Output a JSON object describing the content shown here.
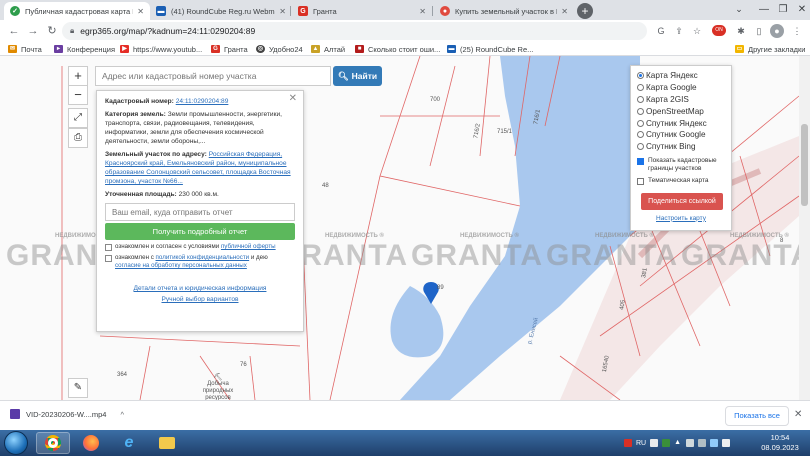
{
  "browser": {
    "tabs": [
      {
        "title": "Публичная кадастровая карта Р",
        "favicon": "check",
        "color": "#2e9d4c",
        "active": true
      },
      {
        "title": "(41) RoundCube Reg.ru Webmail",
        "favicon": "mail",
        "color": "#1a5fb4",
        "active": false
      },
      {
        "title": "Гранта",
        "favicon": "G",
        "color": "#d93025",
        "active": false
      },
      {
        "title": "Купить земельный участок в Кр",
        "favicon": "pin",
        "color": "#e04a3f",
        "active": false
      }
    ],
    "url": "egrp365.org/map/?kadnum=24:11:0290204:89",
    "bookmarks": [
      {
        "label": "Почта",
        "color": "#e08a00"
      },
      {
        "label": "Конференция",
        "color": "#6a3ea1"
      },
      {
        "label": "https://www.youtub...",
        "color": "#e52d27"
      },
      {
        "label": "Гранта",
        "color": "#d93025"
      },
      {
        "label": "Удобно24",
        "color": "#444444"
      },
      {
        "label": "Алтай",
        "color": "#c9a227"
      },
      {
        "label": "Сколько стоит оши...",
        "color": "#b31b1b"
      },
      {
        "label": "(25) RoundCube Re...",
        "color": "#1a5fb4"
      }
    ],
    "other_bookmarks": "Другие закладки"
  },
  "map": {
    "search": {
      "placeholder": "Адрес или кадастровый номер участка",
      "button": "Найти"
    },
    "zoom_in": "+",
    "zoom_out": "−",
    "labels": [
      "700",
      "716/2",
      "716/1",
      "715/1",
      "48",
      "89",
      "76",
      "364",
      "Добыча природных ресурсов",
      "р. Енисей",
      "381",
      "405",
      "16540",
      "8"
    ],
    "watermark": "GRANTA",
    "watermark_small": "НЕДВИЖИМОСТЬ ®"
  },
  "info": {
    "cadnum_label": "Кадастровый номер:",
    "cadnum": "24:11:0290204:89",
    "category_label": "Категория земель:",
    "category": "Земли промышленности, энергетики, транспорта, связи, радиовещания, телевидения, информатики, земли для обеспечения космической деятельности, земли обороны,...",
    "address_label": "Земельный участок по адресу:",
    "address": "Российская Федерация, Красноярский край, Емельяновский район, муниципальное образование Солонцовский сельсовет, площадка Восточная промзона, участок №66...",
    "area_label": "Уточненная площадь:",
    "area": "230 000 кв.м.",
    "email_placeholder": "Ваш email, куда отправить отчет",
    "get_report": "Получить подробный отчет",
    "consent1_pre": "ознакомлен и согласен с условиями ",
    "consent1_link": "публичной оферты",
    "consent2_pre": "ознакомлен с ",
    "consent2_link1": "политикой конфиденциальности",
    "consent2_mid": " и дею ",
    "consent2_link2": "согласие на обработку персональных данных",
    "details_link": "Детали отчета и юридическая информация",
    "manual_link": "Ручной выбор вариантов"
  },
  "layers": {
    "options": [
      {
        "label": "Карта Яндекс",
        "selected": true
      },
      {
        "label": "Карта Google",
        "selected": false
      },
      {
        "label": "Карта 2GIS",
        "selected": false
      },
      {
        "label": "OpenStreetMap",
        "selected": false
      },
      {
        "label": "Спутник Яндекс",
        "selected": false
      },
      {
        "label": "Спутник Google",
        "selected": false
      },
      {
        "label": "Спутник Bing",
        "selected": false
      }
    ],
    "show_borders": "Показать кадастровые границы участков",
    "thematic": "Тематическая карта",
    "share": "Поделиться ссылкой",
    "customize": "Настроить карту"
  },
  "download": {
    "file": "VID-20230206-W....mp4",
    "show_all": "Показать все"
  },
  "taskbar": {
    "lang": "RU",
    "time": "10:54",
    "date": "08.09.2023"
  }
}
